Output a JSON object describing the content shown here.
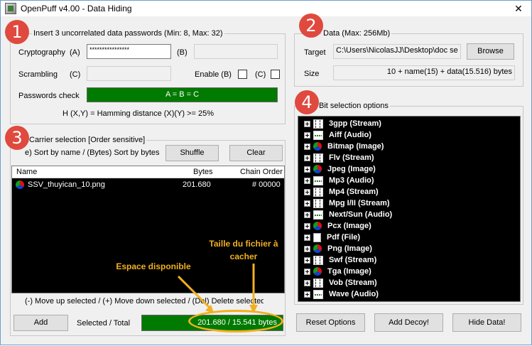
{
  "window": {
    "title": "OpenPuff v4.00 - Data Hiding",
    "close_glyph": "✕"
  },
  "passwords": {
    "group_title": "Insert 3 uncorrelated data passwords (Min: 8, Max: 32)",
    "crypto_label": "Cryptography",
    "a_label": "(A)",
    "a_value": "****************",
    "b_label": "(B)",
    "scrambling_label": "Scrambling",
    "c_label": "(C)",
    "enable_b_label": "Enable (B)",
    "c_check_label": "(C)",
    "check_label": "Passwords check",
    "check_value": "A = B = C",
    "hamming_text": "H (X,Y) = Hamming distance (X)(Y) >= 25%"
  },
  "data": {
    "group_title": "Data (Max: 256Mb)",
    "target_label": "Target",
    "target_value": "C:\\Users\\NicolasJJ\\Desktop\\doc se",
    "browse_label": "Browse",
    "size_label": "Size",
    "size_value": "10 + name(15) + data(15.516) bytes"
  },
  "carrier": {
    "group_title": "Carrier selection [Order sensitive]",
    "sort_text": "e) Sort by name / (Bytes) Sort by bytes",
    "shuffle_label": "Shuffle",
    "clear_label": "Clear",
    "columns": [
      "Name",
      "Bytes",
      "Chain Order"
    ],
    "rows": [
      {
        "name": "SSV_thuyican_10.png",
        "bytes": "201.680",
        "order": "# 00000"
      }
    ],
    "move_text": "(-) Move up selected / (+) Move down selected / (Del) Delete selected",
    "add_label": "Add",
    "selected_total_label": "Selected / Total",
    "selected_total_value": "201.680 / 15.541 bytes"
  },
  "bits": {
    "group_title": "Bit selection options",
    "items": [
      {
        "label": "3gpp (Stream)",
        "icon": "film"
      },
      {
        "label": "Aiff (Audio)",
        "icon": "wave"
      },
      {
        "label": "Bitmap (Image)",
        "icon": "image"
      },
      {
        "label": "Flv (Stream)",
        "icon": "film"
      },
      {
        "label": "Jpeg (Image)",
        "icon": "image"
      },
      {
        "label": "Mp3 (Audio)",
        "icon": "wave"
      },
      {
        "label": "Mp4 (Stream)",
        "icon": "film"
      },
      {
        "label": "Mpg I/II (Stream)",
        "icon": "film"
      },
      {
        "label": "Next/Sun (Audio)",
        "icon": "wave"
      },
      {
        "label": "Pcx (Image)",
        "icon": "image"
      },
      {
        "label": "Pdf (File)",
        "icon": "file"
      },
      {
        "label": "Png (Image)",
        "icon": "image"
      },
      {
        "label": "Swf (Stream)",
        "icon": "film"
      },
      {
        "label": "Tga (Image)",
        "icon": "image"
      },
      {
        "label": "Vob (Stream)",
        "icon": "film"
      },
      {
        "label": "Wave (Audio)",
        "icon": "wave"
      }
    ]
  },
  "buttons": {
    "reset": "Reset Options",
    "decoy": "Add Decoy!",
    "hide": "Hide Data!"
  },
  "badges": [
    "1",
    "2",
    "3",
    "4"
  ],
  "annotations": {
    "espace": "Espace disponible",
    "taille": "Taille du fichier à cacher"
  },
  "colors": {
    "badge": "#e0493e",
    "annotation": "#f0b020",
    "check_bar": "#007a00"
  }
}
